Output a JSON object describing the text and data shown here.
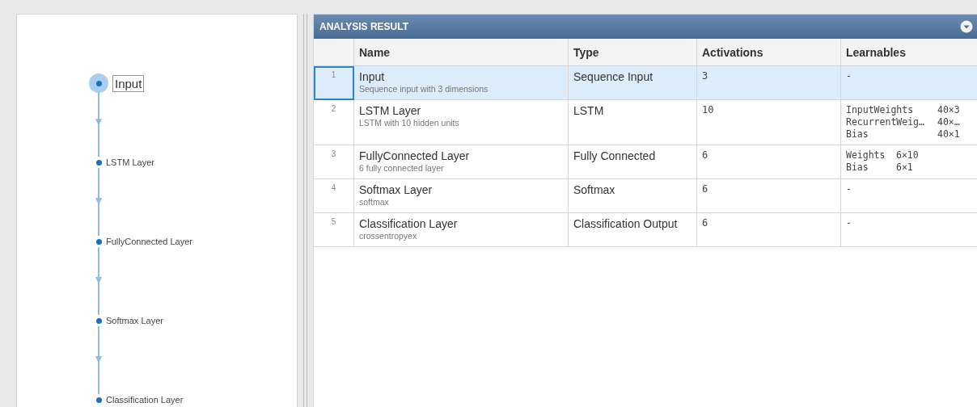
{
  "graph": {
    "nodes": [
      {
        "label": "Input",
        "selected": true
      },
      {
        "label": "LSTM Layer",
        "selected": false
      },
      {
        "label": "FullyConnected Layer",
        "selected": false
      },
      {
        "label": "Softmax Layer",
        "selected": false
      },
      {
        "label": "Classification Layer",
        "selected": false
      }
    ]
  },
  "results": {
    "title": "ANALYSIS RESULT",
    "columns": [
      "Name",
      "Type",
      "Activations",
      "Learnables"
    ],
    "rows": [
      {
        "index": "1",
        "name": "Input",
        "description": "Sequence input with 3 dimensions",
        "type": "Sequence Input",
        "activations": "3",
        "learnables": [
          {
            "name": "-"
          }
        ],
        "selected": true
      },
      {
        "index": "2",
        "name": "LSTM Layer",
        "description": "LSTM with 10 hidden units",
        "type": "LSTM",
        "activations": "10",
        "learnables": [
          {
            "name": "InputWeights",
            "size": "40×3"
          },
          {
            "name": "RecurrentWeig…",
            "size": "40×…"
          },
          {
            "name": "Bias",
            "size": "40×1"
          }
        ],
        "selected": false
      },
      {
        "index": "3",
        "name": "FullyConnected Layer",
        "description": "6 fully connected layer",
        "type": "Fully Connected",
        "activations": "6",
        "learnables": [
          {
            "name": "Weights",
            "size": "6×10"
          },
          {
            "name": "Bias",
            "size": "6×1"
          }
        ],
        "selected": false
      },
      {
        "index": "4",
        "name": "Softmax Layer",
        "description": "softmax",
        "type": "Softmax",
        "activations": "6",
        "learnables": [
          {
            "name": "-"
          }
        ],
        "selected": false
      },
      {
        "index": "5",
        "name": "Classification Layer",
        "description": "crossentropyex",
        "type": "Classification Output",
        "activations": "6",
        "learnables": [
          {
            "name": "-"
          }
        ],
        "selected": false
      }
    ]
  }
}
